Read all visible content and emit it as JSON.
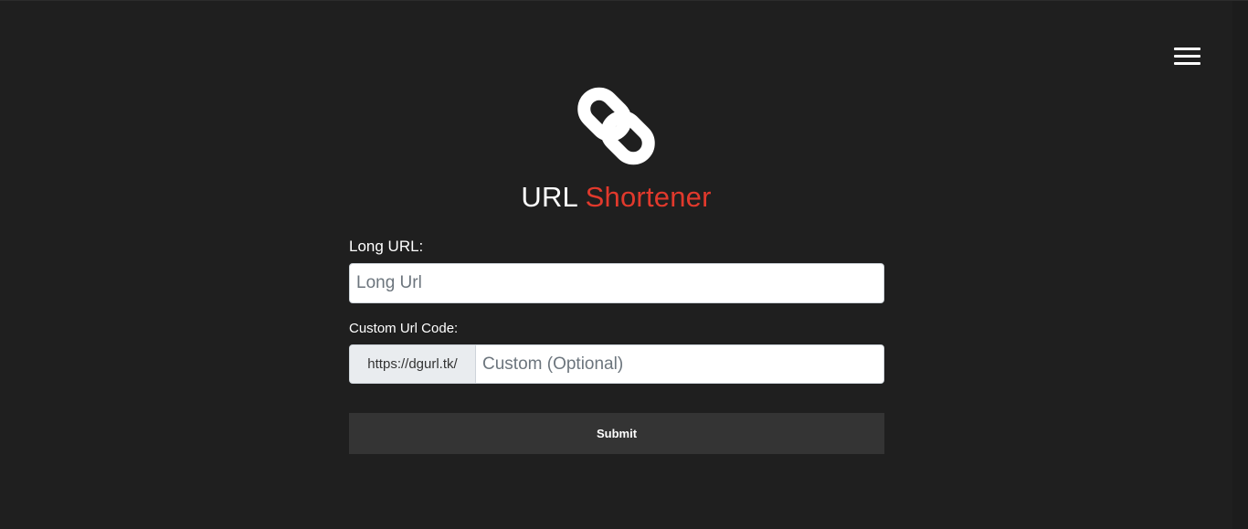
{
  "header": {
    "menu_icon": "hamburger-menu-icon"
  },
  "brand": {
    "logo_icon": "chain-link-icon",
    "title_part1": "URL",
    "title_part2": "Shortener",
    "accent_color": "#e1392c"
  },
  "form": {
    "long_url_label": "Long URL:",
    "long_url_placeholder": "Long Url",
    "long_url_value": "",
    "custom_code_label": "Custom Url Code:",
    "custom_code_prefix": "https://dgurl.tk/",
    "custom_code_placeholder": "Custom (Optional)",
    "custom_code_value": "",
    "submit_label": "Submit"
  }
}
